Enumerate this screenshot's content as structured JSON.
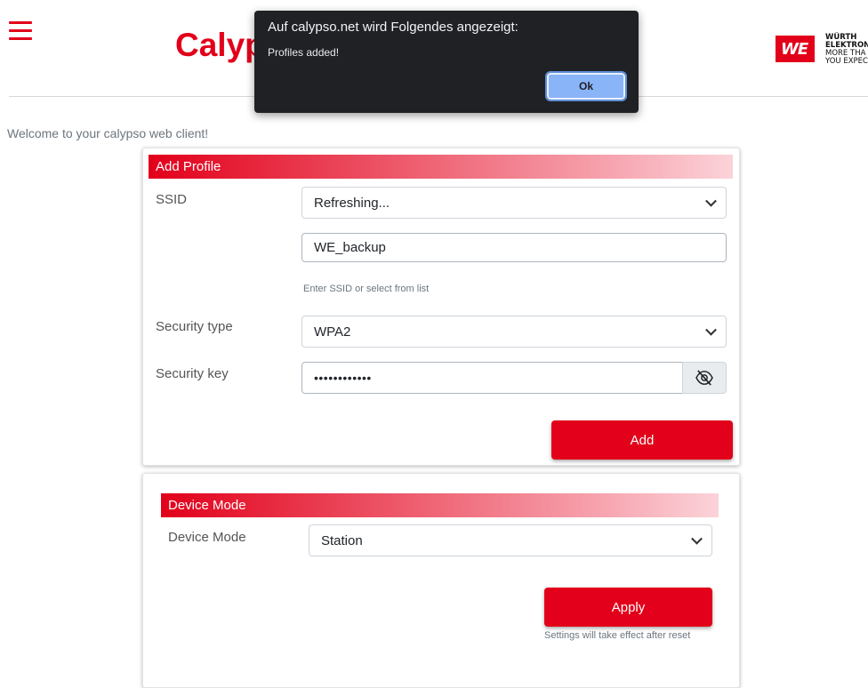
{
  "header": {
    "app_title": "Calyp",
    "logo": {
      "mark": "WE",
      "line1": "WÜRTH",
      "line2": "ELEKTRON",
      "line3": "MORE THA",
      "line4": "YOU EXPEC"
    }
  },
  "welcome_text": "Welcome to your calypso web client!",
  "alert": {
    "title": "Auf calypso.net wird Folgendes angezeigt:",
    "message": "Profiles added!",
    "ok_label": "Ok"
  },
  "add_profile": {
    "title": "Add Profile",
    "ssid_label": "SSID",
    "ssid_select_value": "Refreshing...",
    "ssid_input_value": "WE_backup",
    "ssid_help": "Enter SSID or select from list",
    "security_type_label": "Security type",
    "security_type_value": "WPA2",
    "security_key_label": "Security key",
    "security_key_value": "••••••••••••",
    "add_label": "Add"
  },
  "device_mode": {
    "title": "Device Mode",
    "mode_label": "Device Mode",
    "mode_value": "Station",
    "apply_label": "Apply",
    "apply_note": "Settings will take effect after reset"
  },
  "colors": {
    "accent": "#e2001a",
    "dialog_bg": "#202124",
    "dialog_button": "#8ab4f8"
  },
  "icons": [
    "hamburger-menu-icon",
    "chevron-down-icon",
    "eye-slash-icon"
  ]
}
